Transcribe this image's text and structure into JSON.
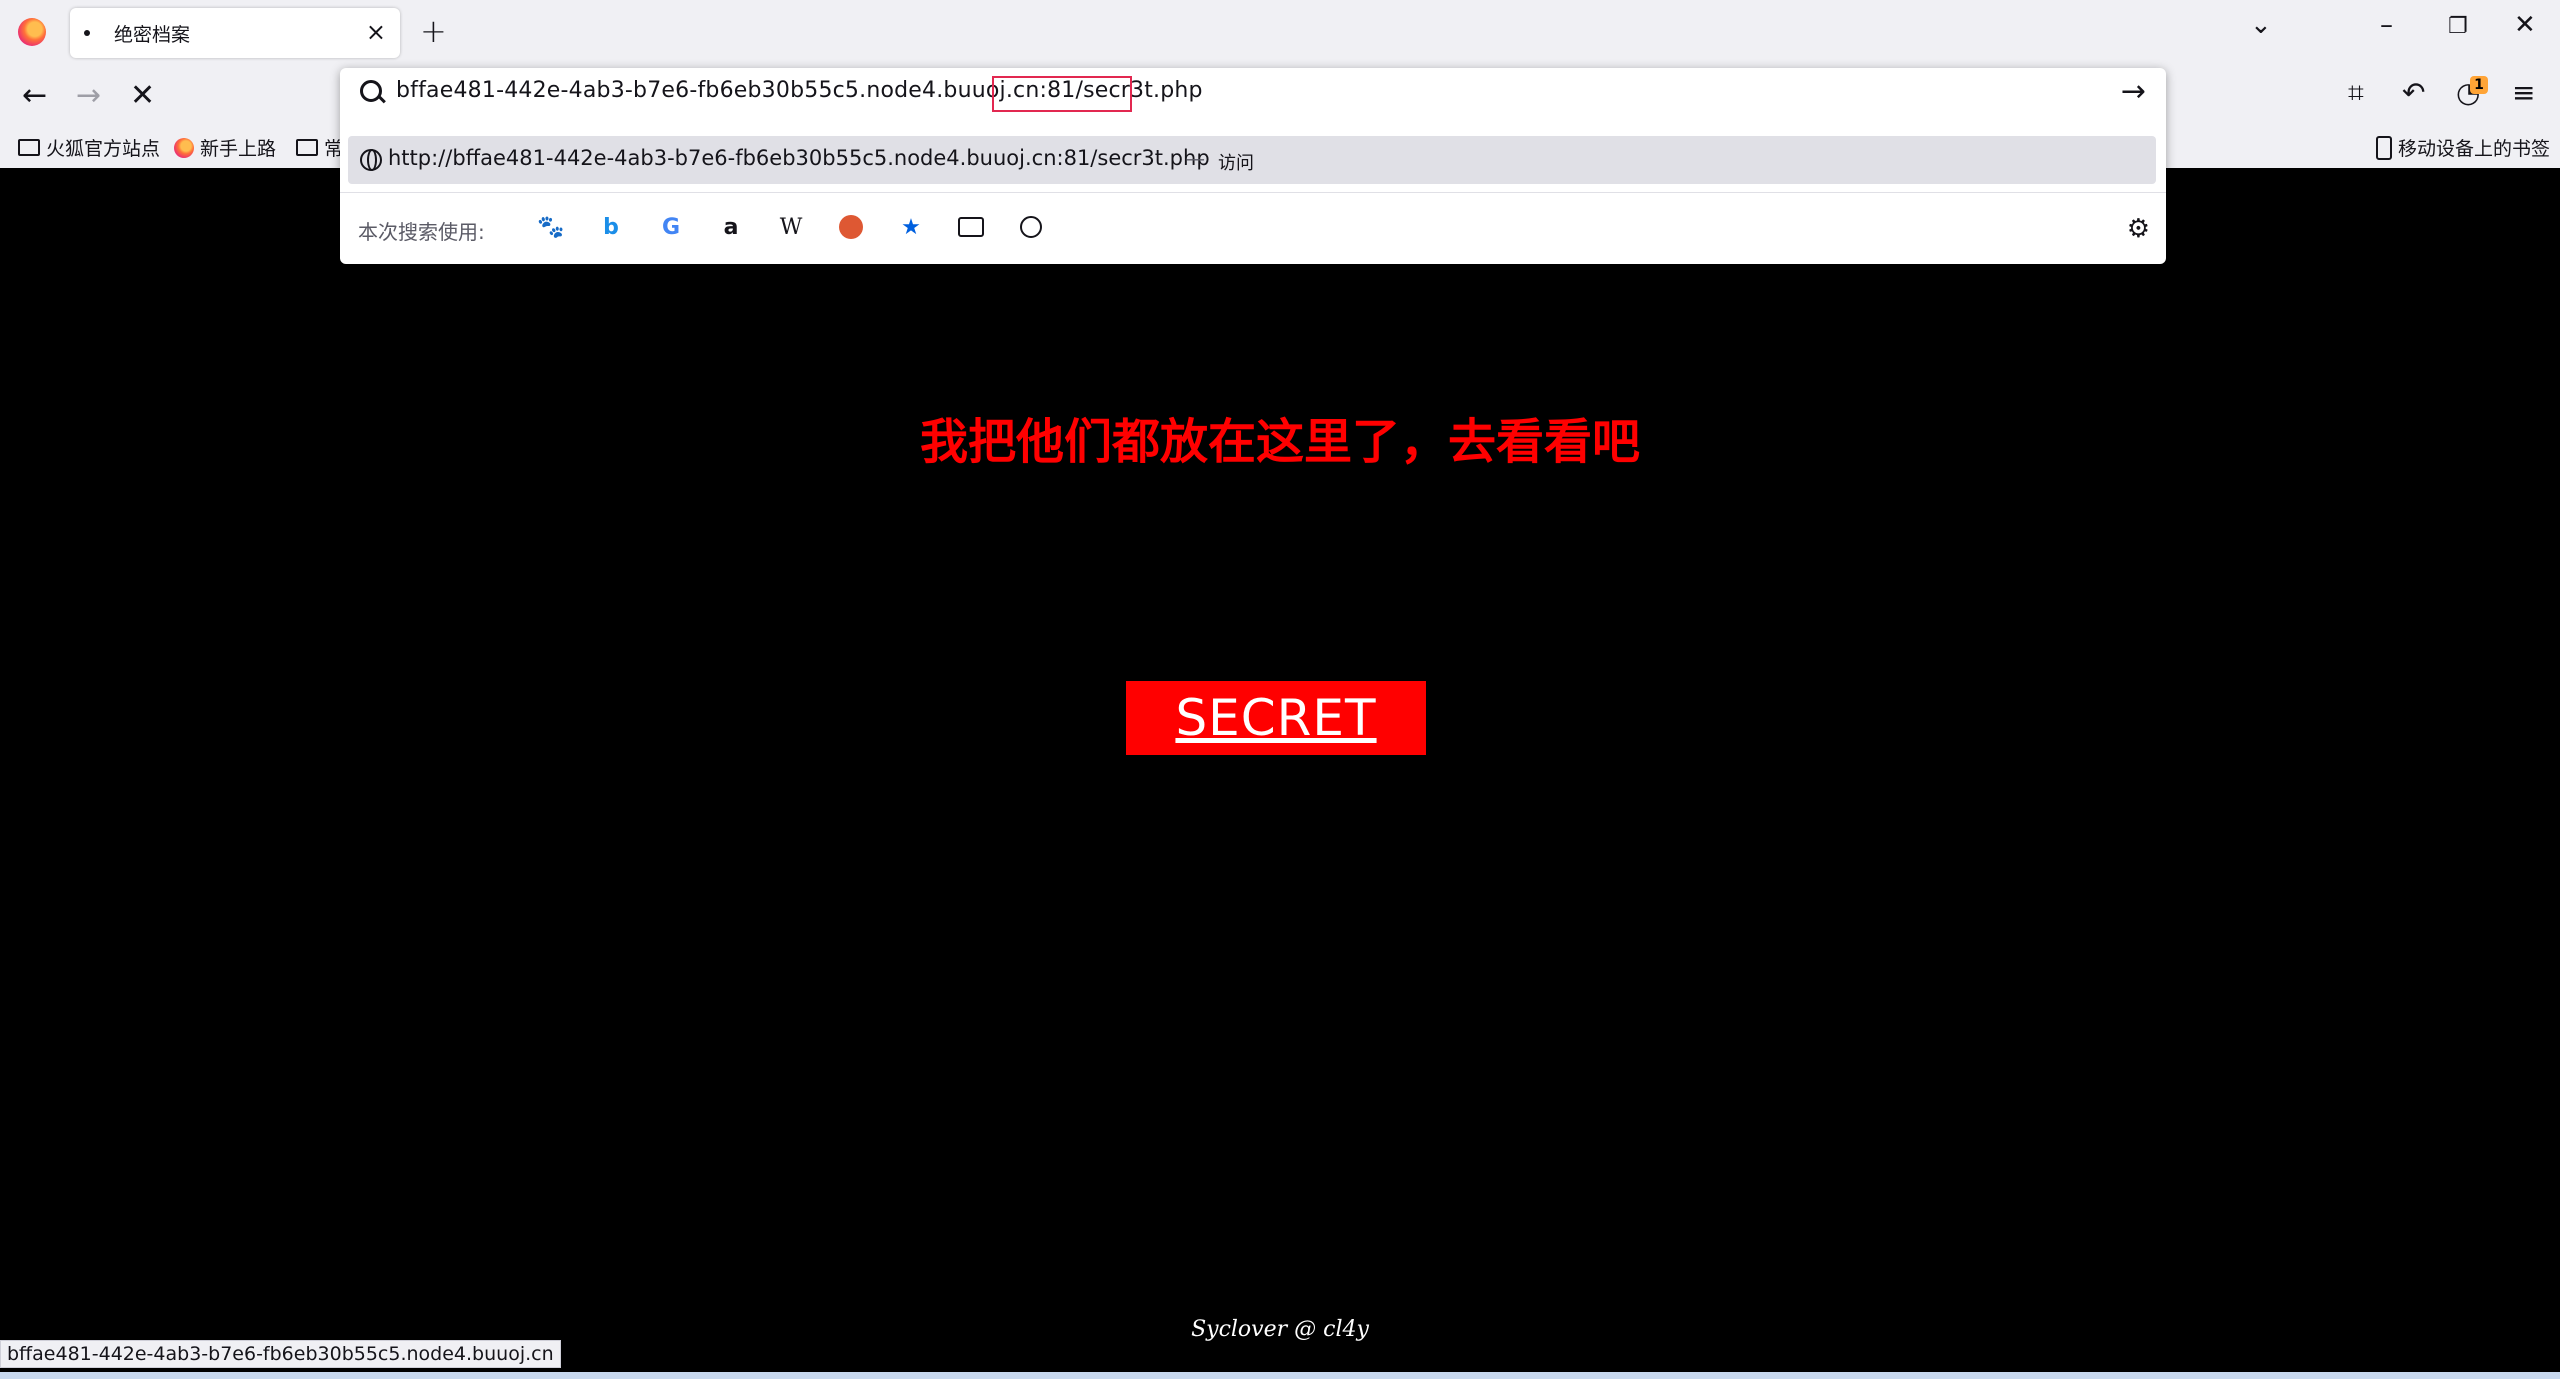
{
  "tab": {
    "title": "绝密档案"
  },
  "toolbar": {
    "badge_count": "1"
  },
  "urlbar": {
    "value": "bffae481-442e-4ab3-b7e6-fb6eb30b55c5.node4.buuoj.cn:81/secr3t.php",
    "suggestion_url": "http://bffae481-442e-4ab3-b7e6-fb6eb30b55c5.node4.buuoj.cn:81/secr3t.php",
    "suggestion_dash": "—",
    "suggestion_action": "访问",
    "search_with_label": "本次搜索使用:",
    "engines": [
      "baidu",
      "bing",
      "google",
      "amazon",
      "wikipedia",
      "duckduckgo",
      "bookmarks",
      "tabs",
      "history"
    ]
  },
  "bookmarks": {
    "items": [
      "火狐官方站点",
      "新手上路",
      "常"
    ],
    "mobile": "移动设备上的书签"
  },
  "page": {
    "headline": "我把他们都放在这里了，去看看吧",
    "button_label": "SECRET",
    "footer": "Syclover @ cl4y"
  },
  "status_bar": {
    "text": "bffae481-442e-4ab3-b7e6-fb6eb30b55c5.node4.buuoj.cn"
  },
  "colors": {
    "accent": "#ff0000",
    "chrome": "#f0f0f4",
    "page_bg": "#000000"
  }
}
